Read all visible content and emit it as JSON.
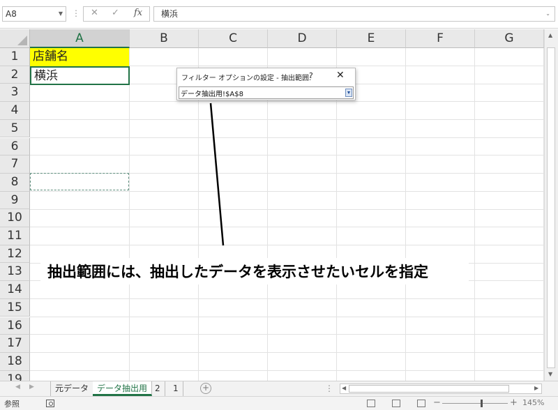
{
  "formula_bar": {
    "name_box": "A8",
    "formula": "横浜"
  },
  "grid": {
    "columns": [
      "A",
      "B",
      "C",
      "D",
      "E",
      "F",
      "G"
    ],
    "rows": [
      "1",
      "2",
      "3",
      "4",
      "5",
      "6",
      "7",
      "8",
      "9",
      "10",
      "11",
      "12",
      "13",
      "14",
      "15",
      "16",
      "17",
      "18",
      "19"
    ],
    "selected_column": "A",
    "cells": {
      "A1": "店舗名",
      "A2": "横浜"
    },
    "highlight_color": "#ffff00",
    "accent_color": "#217346"
  },
  "dialog": {
    "title": "フィルター オプションの設定 - 抽出範囲:",
    "help": "?",
    "close": "✕",
    "value": "データ抽出用!$A$8"
  },
  "annotation": {
    "text": "抽出範囲には、抽出したデータを表示させたいセルを指定"
  },
  "sheet_tabs": {
    "tabs": [
      "元データ",
      "データ抽出用",
      "2",
      "1"
    ],
    "active": "データ抽出用"
  },
  "status_bar": {
    "mode": "参照",
    "zoom": "145%"
  }
}
